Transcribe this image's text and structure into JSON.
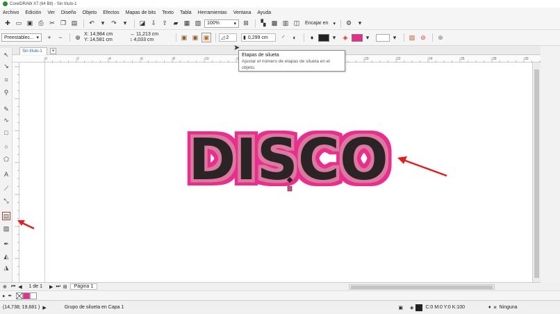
{
  "window": {
    "title": "CorelDRAW X7 (64 Bit) - Sin título-1"
  },
  "menu": [
    "Archivo",
    "Edición",
    "Ver",
    "Diseño",
    "Objeto",
    "Efectos",
    "Mapas de bits",
    "Texto",
    "Tabla",
    "Herramientas",
    "Ventana",
    "Ayuda"
  ],
  "toolbar": {
    "zoom": "100%",
    "snap": "Encajar en"
  },
  "propbar": {
    "preset": "Preestablec...",
    "x": "X: 14,984 cm",
    "y": "Y: 14,581 cm",
    "w": "11,213 cm",
    "h": "4,033 cm",
    "steps": "2",
    "offset": "0,299 cm",
    "outline_color": "#222222",
    "fill_color": "#ed2b8c"
  },
  "doc_tab": "Sin título-1",
  "tooltip": {
    "title": "Etapas de silueta",
    "desc": "Ajustar el número de etapas de silueta en el objeto."
  },
  "ruler_labels": [
    "0",
    "2",
    "4",
    "6",
    "8",
    "10",
    "12",
    "14",
    "16",
    "18",
    "20",
    "22",
    "24",
    "26",
    "28",
    "30"
  ],
  "artwork": {
    "text": "DISCO",
    "text_color": "#2b2426",
    "contour_outer": "#ea2d8e",
    "contour_inner": "#d97a9e"
  },
  "pagebar": {
    "page_count": "1 de 1",
    "page_tab": "Página 1"
  },
  "status": {
    "coords": "(14,738; 19,681 )",
    "selection": "Grupo de silueta en Capa 1",
    "fill_info": "C:0 M:0 Y:0 K:100",
    "outline_info": "Ninguna"
  },
  "annotation_color": "#e01e1e"
}
